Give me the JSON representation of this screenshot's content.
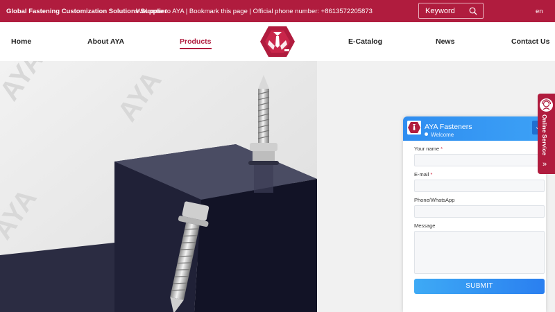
{
  "topbar": {
    "tagline": "Global Fastening Customization Solutions Supplier",
    "welcome": "Welcome to AYA | Bookmark this page | Official phone number: +8613572205873",
    "search_placeholder": "Keyword",
    "search_icon": "search-icon",
    "language": "en"
  },
  "nav": {
    "items": [
      {
        "label": "Home"
      },
      {
        "label": "About AYA"
      },
      {
        "label": "Products"
      },
      {
        "label": "E-Catalog"
      },
      {
        "label": "News"
      },
      {
        "label": "Contact Us"
      }
    ],
    "active": "Products",
    "logo_icon": "aya-shield-logo"
  },
  "hero": {
    "watermark": "AYA",
    "image_subject": "self-drilling screws on dark cube"
  },
  "chat": {
    "title": "AYA Fasteners",
    "status": "Welcome",
    "minimize_icon": "chevron-down-icon",
    "fields": {
      "name_label": "Your name",
      "email_label": "E-mail",
      "phone_label": "Phone/WhatsApp",
      "message_label": "Message",
      "required_mark": "*"
    },
    "submit_label": "SUBMIT"
  },
  "service_tab": {
    "label": "Online Service",
    "arrow": "»"
  },
  "colors": {
    "brand": "#b01c3e",
    "chat_blue": "#2f8df0"
  }
}
